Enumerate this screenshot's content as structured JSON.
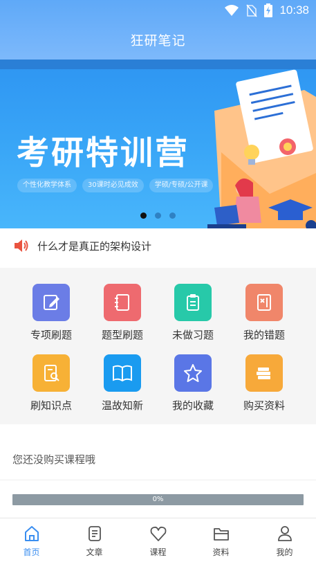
{
  "status_bar": {
    "time": "10:38"
  },
  "header": {
    "title": "狂研笔记"
  },
  "banner": {
    "title": "考研特训营",
    "tags": [
      "个性化教学体系",
      "30课时必见成效",
      "学硕/专硕/公开课"
    ],
    "dots": 3,
    "active_dot": 0
  },
  "notice": {
    "text": "什么才是真正的架构设计"
  },
  "grid": [
    {
      "label": "专项刷题",
      "icon": "edit-icon",
      "color": "#6b7de6"
    },
    {
      "label": "题型刷题",
      "icon": "notebook-icon",
      "color": "#ee6a6f"
    },
    {
      "label": "未做习题",
      "icon": "clipboard-icon",
      "color": "#27c9a9"
    },
    {
      "label": "我的错题",
      "icon": "wrong-book-icon",
      "color": "#f0866a"
    },
    {
      "label": "刷知识点",
      "icon": "search-doc-icon",
      "color": "#f7b136"
    },
    {
      "label": "温故知新",
      "icon": "book-icon",
      "color": "#1a9bf0"
    },
    {
      "label": "我的收藏",
      "icon": "star-icon",
      "color": "#5a76e6"
    },
    {
      "label": "购买资料",
      "icon": "books-stack-icon",
      "color": "#f7a93a"
    }
  ],
  "course": {
    "empty_text": "您还没购买课程哦",
    "progress_text": "0%"
  },
  "nav": [
    {
      "label": "首页",
      "icon": "home-icon",
      "active": true
    },
    {
      "label": "文章",
      "icon": "article-icon",
      "active": false
    },
    {
      "label": "课程",
      "icon": "heart-icon",
      "active": false
    },
    {
      "label": "资料",
      "icon": "folder-icon",
      "active": false
    },
    {
      "label": "我的",
      "icon": "user-icon",
      "active": false
    }
  ],
  "colors": {
    "header": "#6aaff9",
    "accent": "#3a8ef0",
    "progress": "#8d9aa3"
  }
}
